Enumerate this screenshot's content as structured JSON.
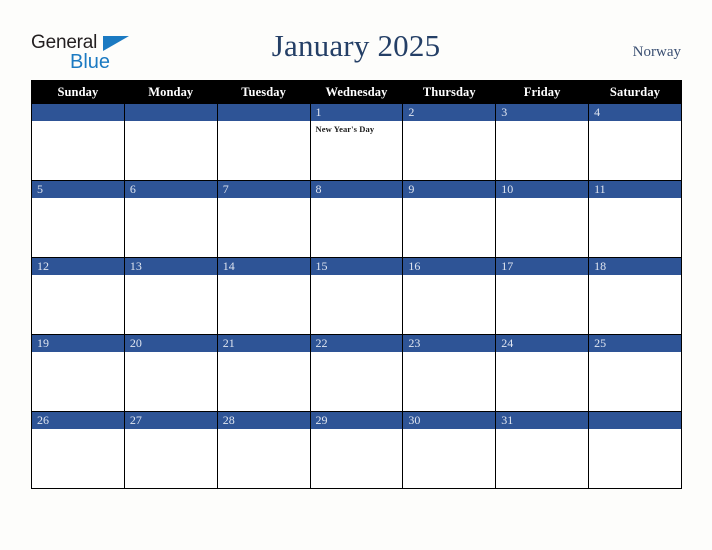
{
  "brand": {
    "name_part1": "General",
    "name_part2": "Blue",
    "triangle_color": "#1b7ac2",
    "text_color": "#231f20"
  },
  "header": {
    "title": "January 2025",
    "country": "Norway",
    "title_color": "#243f66"
  },
  "calendar": {
    "month": "January",
    "year": "2025",
    "weekday_headers": [
      "Sunday",
      "Monday",
      "Tuesday",
      "Wednesday",
      "Thursday",
      "Friday",
      "Saturday"
    ],
    "header_bg": "#000000",
    "header_text_color": "#ffffff",
    "date_bar_color": "#2e5496",
    "date_text_color": "#dfe5f0",
    "cell_bg": "#ffffff",
    "border_color": "#000000",
    "weeks": [
      [
        {
          "date": "",
          "events": []
        },
        {
          "date": "",
          "events": []
        },
        {
          "date": "",
          "events": []
        },
        {
          "date": "1",
          "events": [
            "New Year's Day"
          ]
        },
        {
          "date": "2",
          "events": []
        },
        {
          "date": "3",
          "events": []
        },
        {
          "date": "4",
          "events": []
        }
      ],
      [
        {
          "date": "5",
          "events": []
        },
        {
          "date": "6",
          "events": []
        },
        {
          "date": "7",
          "events": []
        },
        {
          "date": "8",
          "events": []
        },
        {
          "date": "9",
          "events": []
        },
        {
          "date": "10",
          "events": []
        },
        {
          "date": "11",
          "events": []
        }
      ],
      [
        {
          "date": "12",
          "events": []
        },
        {
          "date": "13",
          "events": []
        },
        {
          "date": "14",
          "events": []
        },
        {
          "date": "15",
          "events": []
        },
        {
          "date": "16",
          "events": []
        },
        {
          "date": "17",
          "events": []
        },
        {
          "date": "18",
          "events": []
        }
      ],
      [
        {
          "date": "19",
          "events": []
        },
        {
          "date": "20",
          "events": []
        },
        {
          "date": "21",
          "events": []
        },
        {
          "date": "22",
          "events": []
        },
        {
          "date": "23",
          "events": []
        },
        {
          "date": "24",
          "events": []
        },
        {
          "date": "25",
          "events": []
        }
      ],
      [
        {
          "date": "26",
          "events": []
        },
        {
          "date": "27",
          "events": []
        },
        {
          "date": "28",
          "events": []
        },
        {
          "date": "29",
          "events": []
        },
        {
          "date": "30",
          "events": []
        },
        {
          "date": "31",
          "events": []
        },
        {
          "date": "",
          "events": []
        }
      ]
    ]
  }
}
